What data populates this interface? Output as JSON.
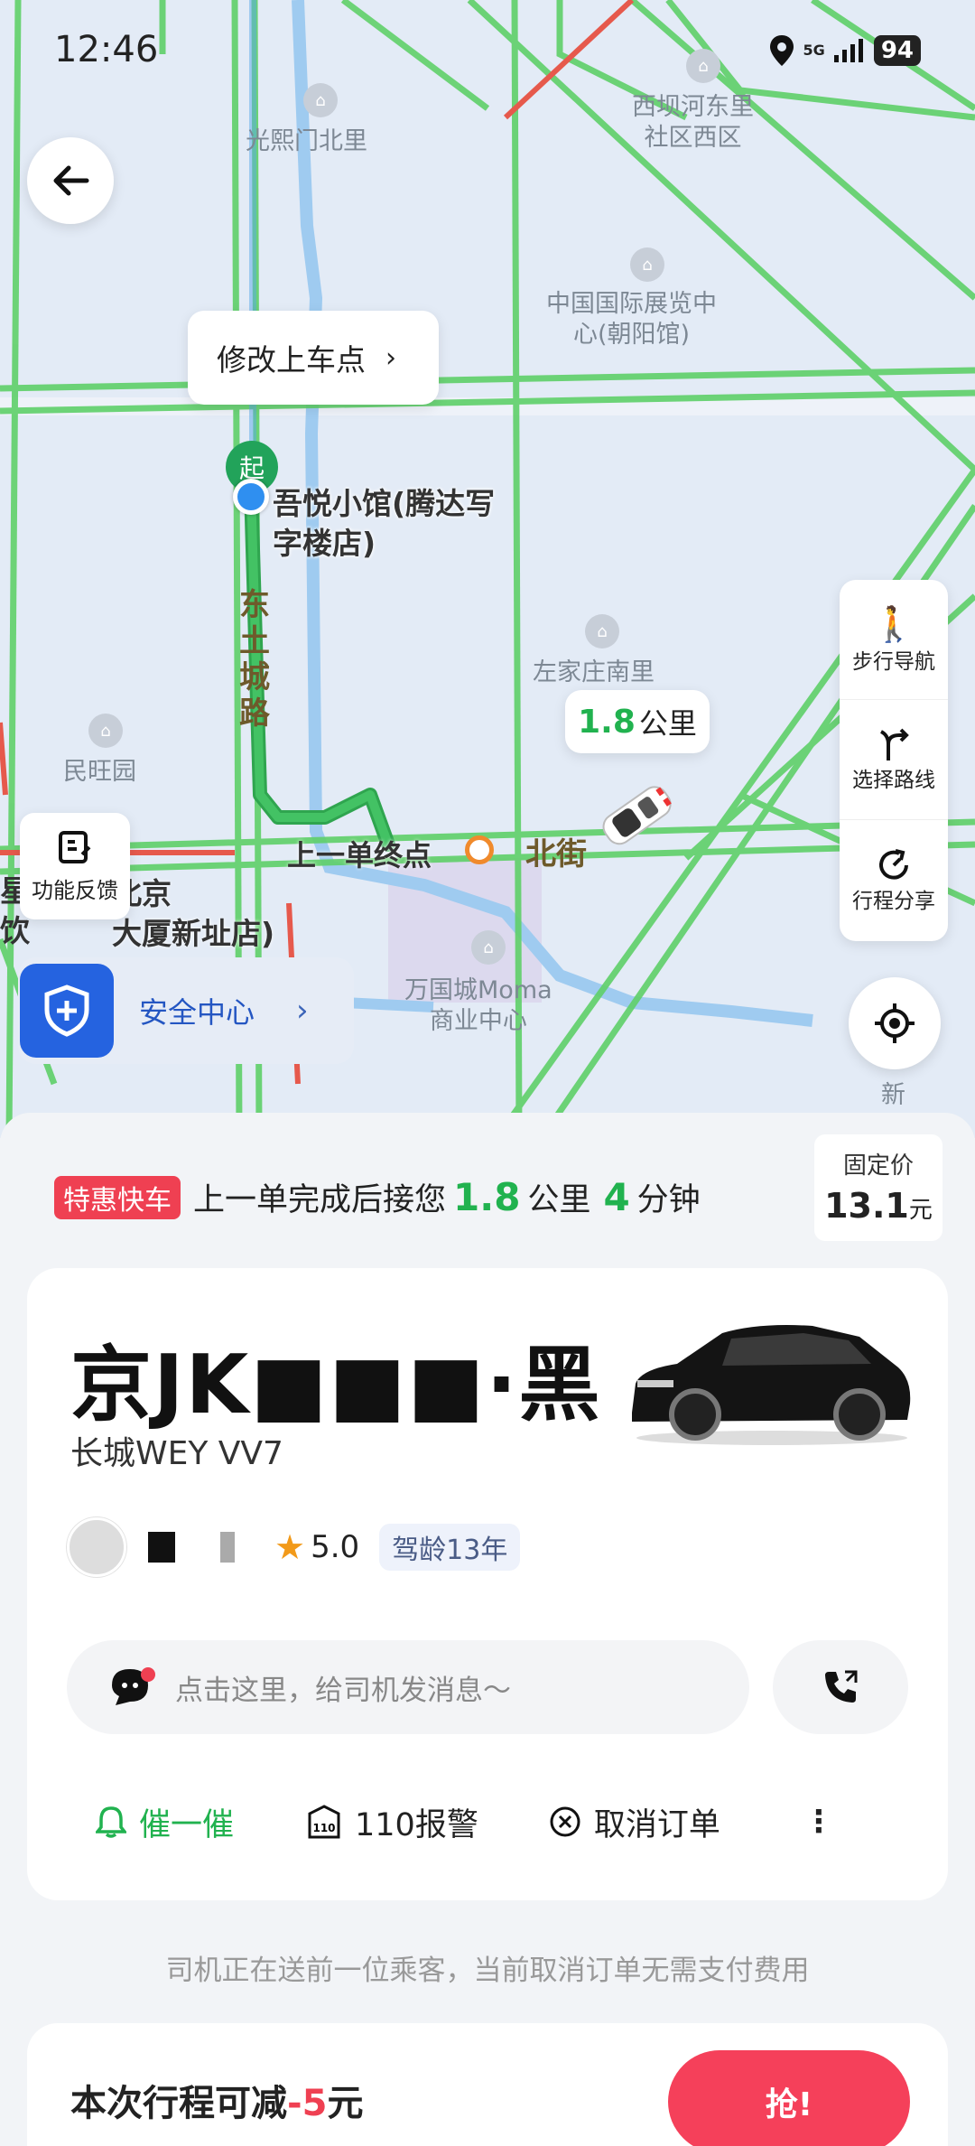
{
  "status_bar": {
    "time": "12:46",
    "network": "5G",
    "battery": "94"
  },
  "map": {
    "labels": {
      "guangximen": "光熙门北里",
      "xiba": "西坝河东里\n社区西区",
      "expo": "中国国际展览中\n心(朝阳馆)",
      "zuojia": "左家庄南里",
      "minwang": "民旺园",
      "wanguocheng": "万国城Moma\n商业中心",
      "xin": "新",
      "road_dongtucheng": "东土城路",
      "road_bei": "北街",
      "road_jing": "京",
      "left_cut_1": "星",
      "left_cut_2": "饮"
    },
    "pickup_edit": "修改上车点",
    "start_marker": "起",
    "pickup_name": "吾悦小馆(腾达写\n字楼店)",
    "hotel_name": "北京\n大厦新址店)",
    "prev_end_label": "上一单终点",
    "distance_value": "1.8",
    "distance_unit": "公里",
    "side_actions": [
      {
        "label": "步行导航"
      },
      {
        "label": "选择路线"
      },
      {
        "label": "行程分享"
      }
    ],
    "feedback_label": "功能反馈",
    "safety_label": "安全中心"
  },
  "promo": {
    "tag": "特惠快车",
    "text_before": "上一单完成后接您",
    "distance": "1.8",
    "distance_unit": "公里",
    "minutes": "4",
    "minutes_unit": "分钟"
  },
  "price": {
    "label": "固定价",
    "value": "13.1",
    "unit": "元"
  },
  "driver": {
    "plate": "京JK■■■·黑",
    "car_model": "长城WEY VV7",
    "rating": "5.0",
    "driving_age": "驾龄13年"
  },
  "message": {
    "placeholder": "点击这里，给司机发消息～"
  },
  "actions": [
    {
      "label": "催一催",
      "color": "#21b24f"
    },
    {
      "label": "110报警",
      "color": "#222222"
    },
    {
      "label": "取消订单",
      "color": "#222222"
    }
  ],
  "notice": "司机正在送前一位乘客，当前取消订单无需支付费用",
  "discount": {
    "text": "本次行程可减",
    "amount": "-5",
    "unit": "元",
    "button": "抢!"
  }
}
